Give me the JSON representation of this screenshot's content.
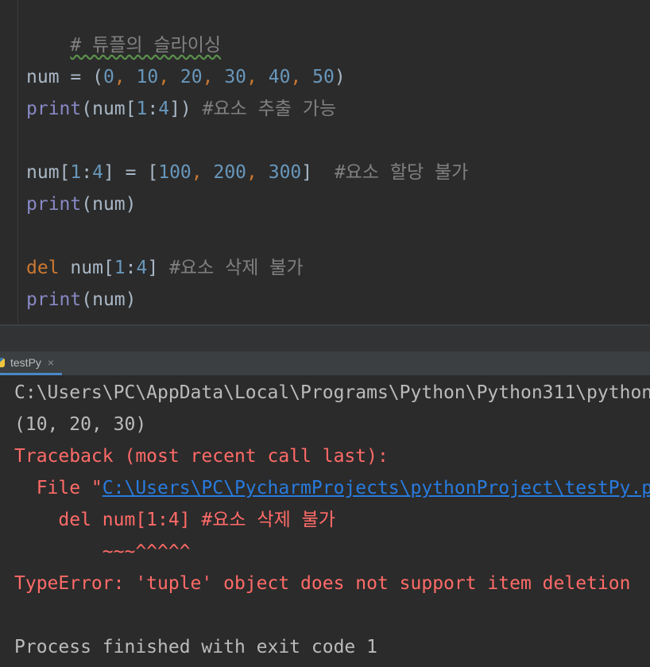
{
  "editor": {
    "line1_comment": "# 튜플의 슬라이싱",
    "line2": {
      "var": "num",
      "eq": " = (",
      "n0": "0",
      "n1": "10",
      "n2": "20",
      "n3": "30",
      "n4": "40",
      "n5": "50",
      "close": ")",
      "sep": ", "
    },
    "line3": {
      "fn": "print",
      "args": "(num[",
      "a": "1",
      "colon": ":",
      "b": "4",
      "end": "]) ",
      "comment": "#요소 추출 가능"
    },
    "line4": {
      "lhs": "num[",
      "a": "1",
      "colon": ":",
      "b": "4",
      "mid": "] = [",
      "v1": "100",
      "v2": "200",
      "v3": "300",
      "sep": ", ",
      "end": "]  ",
      "comment": "#요소 할당 불가"
    },
    "line5": {
      "fn": "print",
      "args": "(num)"
    },
    "line6": {
      "kw": "del",
      "rest": " num[",
      "a": "1",
      "colon": ":",
      "b": "4",
      "end": "] ",
      "comment": "#요소 삭제 불가"
    },
    "line7": {
      "fn": "print",
      "args": "(num)"
    }
  },
  "run_panel": {
    "tab_label": "testPy",
    "tab_close": "×"
  },
  "console": {
    "cmd_line": "C:\\Users\\PC\\AppData\\Local\\Programs\\Python\\Python311\\python",
    "output_line": "(10, 20, 30)",
    "traceback_header": "Traceback (most recent call last):",
    "file_prefix": "  File \"",
    "file_path": "C:\\Users\\PC\\PycharmProjects\\pythonProject\\testPy.p",
    "code_line": "    del num[1:4] #요소 삭제 불가",
    "caret_line": "        ~~~^^^^^",
    "error_line": "TypeError: 'tuple' object does not support item deletion",
    "exit_line": "Process finished with exit code 1"
  },
  "colors": {
    "background": "#2b2b2b",
    "comment": "#808080",
    "number": "#6897bb",
    "builtin": "#8888c6",
    "keyword": "#cc7832",
    "error": "#ff6b68",
    "link": "#287bde"
  }
}
